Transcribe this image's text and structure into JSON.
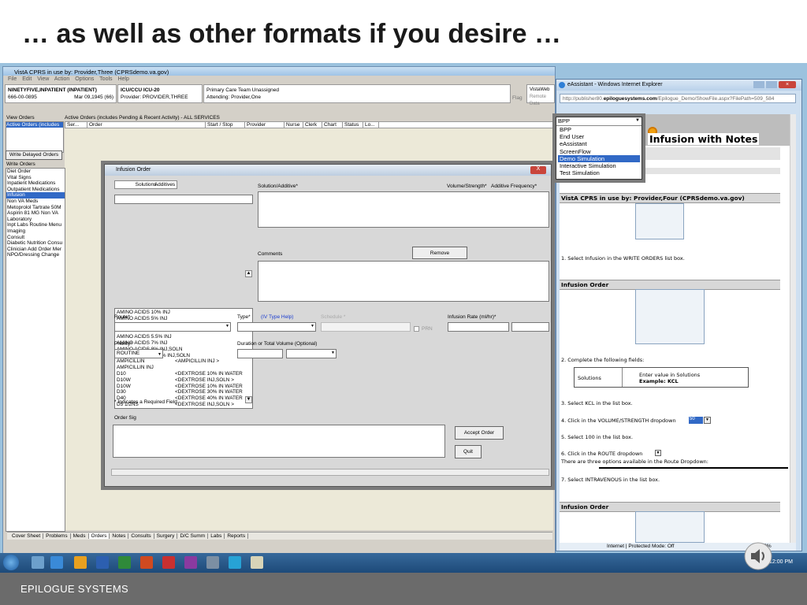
{
  "slide": {
    "title": "… as well as other formats if you desire …",
    "footer": "EPILOGUE SYSTEMS"
  },
  "cprs": {
    "title": "VistA CPRS in use by: Provider,Three  (CPRSdemo.va.gov)",
    "menu": "File  Edit  View  Action  Options  Tools  Help",
    "patient": {
      "name": "NINETYFIVE,INPATIENT (INPATIENT)",
      "ssn": "666-00-0895",
      "dob": "Mar 09,1945 (66)",
      "location": "ICU/CCU ICU-20",
      "provider": "Provider:  PROVIDER,THREE",
      "team": "Primary Care Team Unassigned",
      "attending": "Attending:  Provider,One",
      "flag": "Flag",
      "vistaweb": "VistaWeb",
      "remote": "Remote Data"
    },
    "view_orders_label": "View Orders",
    "view_orders_selected": "Active Orders (includes",
    "active_orders_title": "Active Orders (includes Pending & Recent Activity) - ALL SERVICES",
    "columns": [
      "Ser...",
      "Order",
      "Start / Stop",
      "Provider",
      "Nurse",
      "Clerk",
      "Chart",
      "Status",
      "Lo..."
    ],
    "write_delayed": "Write Delayed Orders",
    "write_orders_label": "Write Orders",
    "write_orders": [
      "Diet Order",
      "Vital Signs",
      "Inpatient Medications",
      "Outpatient Medications",
      "Infusion",
      "Non VA Meds",
      "Metoprolol Tartrate 50M",
      "Aspirin 81 MG Non VA",
      "Laboratory",
      "Inpt Labs Routine Menu",
      "Imaging",
      "Consult",
      "Diabetic Nutrition Consu",
      "Clinician Add Order Mer",
      "NPO/Dressing Change"
    ],
    "write_orders_selected": 4,
    "tabs": [
      "Cover Sheet",
      "Problems",
      "Meds",
      "Orders",
      "Notes",
      "Consults",
      "Surgery",
      "D/C Summ",
      "Labs",
      "Reports"
    ]
  },
  "dialog": {
    "title": "Infusion Order",
    "close": "X",
    "tabs": [
      "Solutions",
      "Additives"
    ],
    "solutions": [
      [
        "AMINO ACIDS 10% INJ",
        ""
      ],
      [
        "AMINO ACIDS 5% INJ",
        ""
      ],
      [
        "AMINO ACIDS 5.2%-RF INJ",
        ""
      ],
      [
        "AMINO ACIDS 5.4% INJ",
        ""
      ],
      [
        "AMINO ACIDS 5.5% INJ",
        ""
      ],
      [
        "AMINO ACIDS 7% INJ",
        ""
      ],
      [
        "AMINO ACIDS 8% INJ,SOLN",
        ""
      ],
      [
        "AMINOS ACIDS 8.5% INJ,SOLN",
        ""
      ],
      [
        "AMPICILLIN",
        "<AMPICILLIN INJ >"
      ],
      [
        "AMPICILLIN INJ",
        ""
      ],
      [
        "D10",
        "<DEXTROSE 10% IN WATER"
      ],
      [
        "D10W",
        "<DEXTROSE INJ,SOLN >"
      ],
      [
        "D10W",
        "<DEXTROSE 10% IN WATER"
      ],
      [
        "D30",
        "<DEXTROSE 30% IN WATER"
      ],
      [
        "D40",
        "<DEXTROSE 40% IN WATER"
      ],
      [
        "D5 1/2NS",
        "<DEXTROSE INJ,SOLN >"
      ]
    ],
    "solution_additive": "Solution/Additive*",
    "volume_strength": "Volume/Strength*",
    "additive_freq": "Additive Frequency*",
    "comments": "Comments",
    "remove": "Remove",
    "route": "Route*",
    "type": "Type*",
    "iv_help": "(IV Type Help)",
    "schedule": "Schedule *",
    "prn": "PRN",
    "infusion_rate": "Infusion Rate (ml/hr)*",
    "priority": "Priority*",
    "priority_value": "ROUTINE",
    "duration": "Duration or Total Volume (Optional)",
    "required_note": "* Indicates a Required Field",
    "order_sig": "Order Sig",
    "accept": "Accept Order",
    "quit": "Quit"
  },
  "ie": {
    "title": "eAssistant - Windows Internet Explorer",
    "url_plain": "http://publisher80.",
    "url_bold": "epiloguesystems.com",
    "url_rest": "/Epilogue_Demo/ShowFile.aspx?FilePath=509_584",
    "eassistant_label": "eAssistant",
    "heading": "Infusion with Notes",
    "cprs_line": "VistA CPRS in use by: Provider,Four (CPRSdemo.va.gov)",
    "steps": {
      "s1": "1.  Select Infusion in the WRITE ORDERS list box.",
      "s2": "2.  Complete the following fields:",
      "sol_label": "Solutions",
      "sol_hint": "Enter value in Solutions",
      "sol_ex": "Example: KCL",
      "s3": "3.  Select KCL in the  list box.",
      "s4": "4.  Click in the VOLUME/STRENGTH dropdown",
      "s4v": "50",
      "s5": "5.  Select 100 in the  list box.",
      "s6": "6.  Click in the ROUTE  dropdown",
      "s6n": "There are three options available in the Route Dropdown:",
      "s7": "7.  Select INTRAVENOUS in the  list box."
    },
    "section_infusion": "Infusion Order",
    "status": "Internet | Protected Mode: Off",
    "zoom": "100%"
  },
  "format_dropdown": {
    "value": "BPP",
    "options": [
      "BPP",
      "End User",
      "eAssistant",
      "ScreenFlow",
      "Demo Simulation",
      "Interactive Simulation",
      "Test Simulation"
    ],
    "selected": 4
  },
  "taskbar": {
    "clock": "12:00 PM"
  }
}
